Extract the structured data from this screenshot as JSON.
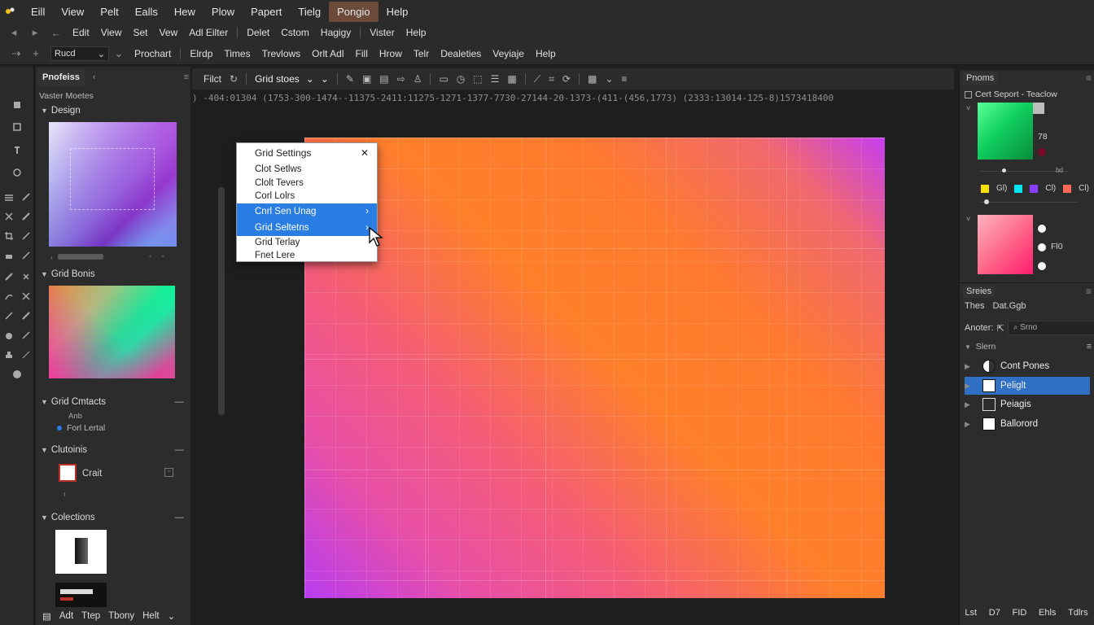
{
  "menu_primary": [
    "Eill",
    "View",
    "Pelt",
    "Ealls",
    "Hew",
    "Plow",
    "Papert",
    "Tielg",
    "Pongio",
    "Help"
  ],
  "menu_secondary": [
    "Edit",
    "View",
    "Set",
    "Vew",
    "Adl Eilter",
    "Delet",
    "Cstom",
    "Hagigy",
    "Vister",
    "Help"
  ],
  "options_bar": {
    "sel1": "Rucd",
    "items": [
      "Prochart",
      "Elrdp",
      "Times",
      "Trevlows",
      "Orlt Adl",
      "Fill",
      "Hrow",
      "Telr",
      "Dealeties",
      "Veyiaje",
      "Help"
    ]
  },
  "canvas_toolbar": {
    "fleet": "Filct",
    "mode": "Grid stoes"
  },
  "coordinates_readout": ") -404:01304 (1753-300-1474--11375-2411:11275-1271-1377-7730-27144-20-1373-(411-(456,1773) (2333:13014-125-8)1573418400",
  "left_panel": {
    "tab": "Pnofeiss",
    "sub": "Vaster Moetes",
    "sect_design": "Design",
    "sect_grid_bonis": "Grid Bonis",
    "sect_grid_contacts": "Grid Cmtacts",
    "grid_contacts_item1": "Anb",
    "grid_contacts_item2": "Forl Lertal",
    "sect_clutoinis": "Clutoinis",
    "crate_label": "Crait",
    "sect_colections": "Colections"
  },
  "bottom_left": [
    "Adt",
    "Ttep",
    "Tbony",
    "Helt"
  ],
  "dropdown": {
    "title": "Grid Settings",
    "items": [
      {
        "label": "Clot Setlws",
        "sub": ""
      },
      {
        "label": "Clolt Tevers",
        "sub": ""
      },
      {
        "label": "Corl Lolrs",
        "sub": ""
      },
      {
        "label": "Cnrl Sen Unag",
        "sub": "›"
      },
      {
        "label": "Grid Seltetns",
        "sub": "›"
      },
      {
        "label": "Grid Terlay",
        "sub": ""
      },
      {
        "label": "Fnet Lere",
        "sub": ""
      }
    ]
  },
  "right_panel": {
    "tab1": "Pnoms",
    "row1": "Cert Seport - Teaclow",
    "green_val": "78",
    "hex_label": "lxl",
    "swatch_label1": "Gl)",
    "swatch_label2": "Cl)",
    "swatch_label3": "Cl)",
    "pink_val": "Fl0",
    "tab2": "Sreies",
    "layer_tabs": [
      "Thes",
      "Dat.Ggb"
    ],
    "anchor_label": "Anoter:",
    "search_placeholder": "Srno",
    "group": "Slern",
    "layers": [
      "Cont Pones",
      "Peliglt",
      "Peiagis",
      "Ballorord"
    ],
    "colors": {
      "yellow": "#f5e000",
      "cyan": "#00e5f0",
      "purple": "#8a3cff",
      "salmon": "#ff6a5a",
      "maroon": "#7a0a2a"
    }
  },
  "bottom_right": [
    "Lst",
    "D7",
    "FID",
    "Ehls",
    "Tdlrs"
  ]
}
